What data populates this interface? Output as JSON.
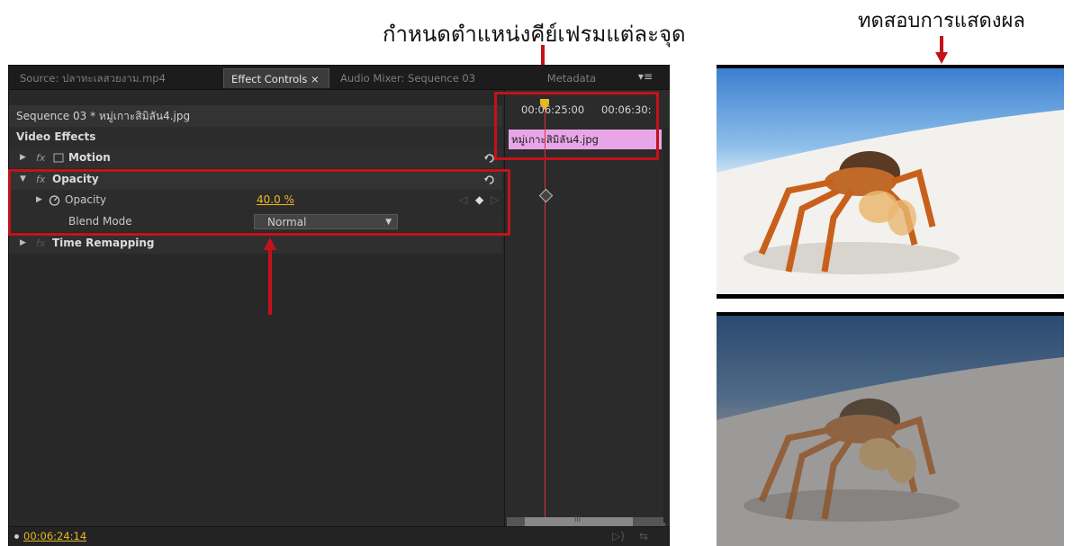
{
  "annotations": {
    "keyframe_label": "กำหนดตำแหน่งคีย์เฟรมแต่ละจุด",
    "result_label": "ทดสอบการแสดงผล"
  },
  "tabs": [
    {
      "label": "Source: ปลาทะเลสวยงาม.mp4",
      "active": false
    },
    {
      "label": "Effect Controls ×",
      "active": true
    },
    {
      "label": "Audio Mixer: Sequence 03",
      "active": false
    },
    {
      "label": "Metadata",
      "active": false
    }
  ],
  "tab_menu": "▾≡",
  "sequence_label": "Sequence 03 * หมู่เกาะสิมิลัน4.jpg",
  "effects": {
    "header": "Video Effects",
    "motion": "Motion",
    "opacity_group": "Opacity",
    "opacity_param": "Opacity",
    "opacity_value": "40.0 %",
    "blend_label": "Blend Mode",
    "blend_value": "Normal",
    "time_remap": "Time Remapping",
    "fx_glyph": "fx"
  },
  "timeline": {
    "tc1": "00:06:25:00",
    "tc2": "00:06:30:",
    "clip_name": "หมู่เกาะสิมิลัน4.jpg",
    "scroll_marker": "III"
  },
  "current_timecode": "00:06:24:14",
  "colors": {
    "highlight_red": "#c4121a",
    "timecode_yellow": "#e8b820",
    "clip_pink": "#e8a6e8"
  },
  "photos": [
    {
      "description_icon": "crab-photo-full-opacity",
      "opacity": 1.0
    },
    {
      "description_icon": "crab-photo-40-opacity",
      "opacity": 0.4
    }
  ]
}
